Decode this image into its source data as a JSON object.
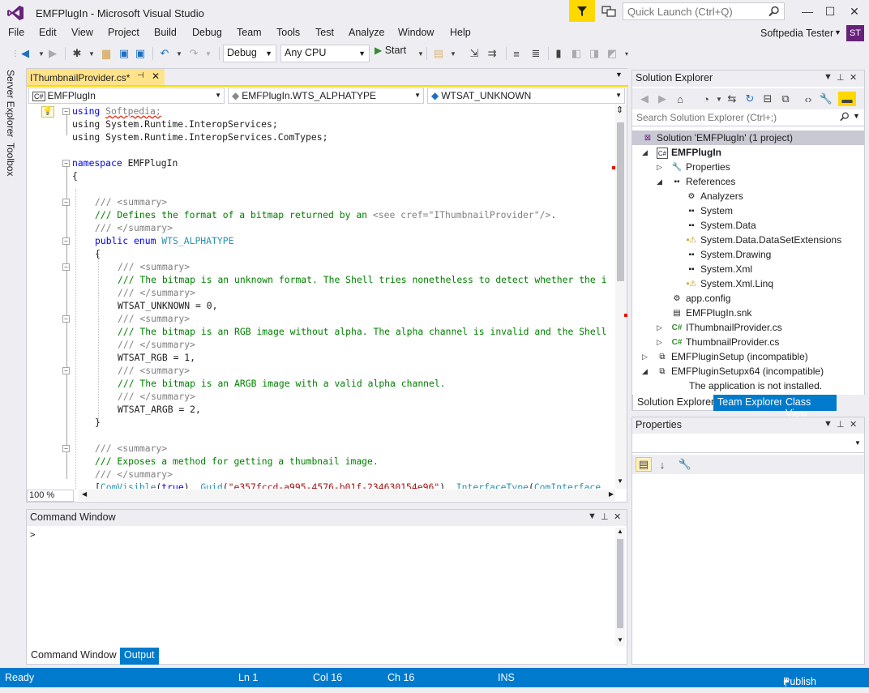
{
  "window": {
    "title": "EMFPlugIn - Microsoft Visual Studio",
    "quick_launch_placeholder": "Quick Launch (Ctrl+Q)",
    "user_name": "Softpedia Tester",
    "avatar_initials": "ST",
    "minimize": "—",
    "maximize": "☐",
    "close": "✕"
  },
  "menu": [
    "File",
    "Edit",
    "View",
    "Project",
    "Build",
    "Debug",
    "Team",
    "Tools",
    "Test",
    "Analyze",
    "Window",
    "Help"
  ],
  "toolbar": {
    "config": "Debug",
    "platform": "Any CPU",
    "start_label": "Start"
  },
  "left_rail": [
    "Server Explorer",
    "Toolbox"
  ],
  "editor": {
    "tab_label": "IThumbnailProvider.cs*",
    "nav_project": "EMFPlugIn",
    "nav_type": "EMFPlugIn.WTS_ALPHATYPE",
    "nav_member": "WTSAT_UNKNOWN",
    "zoom": "100 %",
    "code": {
      "l1_kw": "using",
      "l1_ns": "Softpedia;",
      "l2": "using System.Runtime.InteropServices;",
      "l3": "using System.Runtime.InteropServices.ComTypes;",
      "l5_kw": "namespace",
      "l5_name": " EMFPlugIn",
      "brace_open": "{",
      "brace_close": "}",
      "sum_open": "/// <summary>",
      "sum_close": "/// </summary>",
      "l8_a": "/// Defines the format of a bitmap returned by an ",
      "l8_b": "<see cref=\"IThumbnailProvider\"/>",
      "l8_c": ".",
      "l10_kw": "public enum",
      "l10_type": " WTS_ALPHATYPE",
      "l14": "/// The bitmap is an unknown format. The Shell tries nonetheless to detect whether the i",
      "l16": "WTSAT_UNKNOWN = 0,",
      "l18": "/// The bitmap is an RGB image without alpha. The alpha channel is invalid and the Shell",
      "l20": "WTSAT_RGB = 1,",
      "l22": "/// The bitmap is an ARGB image with a valid alpha channel.",
      "l24": "WTSAT_ARGB = 2,",
      "l28": "/// Exposes a method for getting a thumbnail image.",
      "l30_a": "[",
      "l30_b": "ComVisible",
      "l30_c": "(",
      "l30_d": "true",
      "l30_e": "), ",
      "l30_f": "Guid",
      "l30_g": "(",
      "l30_h": "\"e357fccd-a995-4576-b01f-234630154e96\"",
      "l30_i": "), ",
      "l30_j": "InterfaceType",
      "l30_k": "(",
      "l30_l": "ComInterface"
    }
  },
  "command_window": {
    "title": "Command Window",
    "prompt": ">",
    "tabs": [
      "Command Window",
      "Output"
    ]
  },
  "solution_explorer": {
    "title": "Solution Explorer",
    "search_placeholder": "Search Solution Explorer (Ctrl+;)",
    "tree": [
      "Solution 'EMFPlugIn' (1 project)",
      "EMFPlugIn",
      "Properties",
      "References",
      "Analyzers",
      "System",
      "System.Data",
      "System.Data.DataSetExtensions",
      "System.Drawing",
      "System.Xml",
      "System.Xml.Linq",
      "app.config",
      "EMFPlugIn.snk",
      "IThumbnailProvider.cs",
      "ThumbnailProvider.cs",
      "EMFPluginSetup (incompatible)",
      "EMFPluginSetupx64 (incompatible)",
      "The application is not installed."
    ],
    "tabs": [
      "Solution Explorer",
      "Team Explorer",
      "Class View"
    ]
  },
  "properties": {
    "title": "Properties"
  },
  "status": {
    "ready": "Ready",
    "ln": "Ln 1",
    "col": "Col 16",
    "ch": "Ch 16",
    "ins": "INS",
    "publish": "Publish"
  },
  "colors": {
    "accent": "#007acc",
    "tab_highlight": "#ffd800",
    "vs_purple": "#68217a"
  }
}
